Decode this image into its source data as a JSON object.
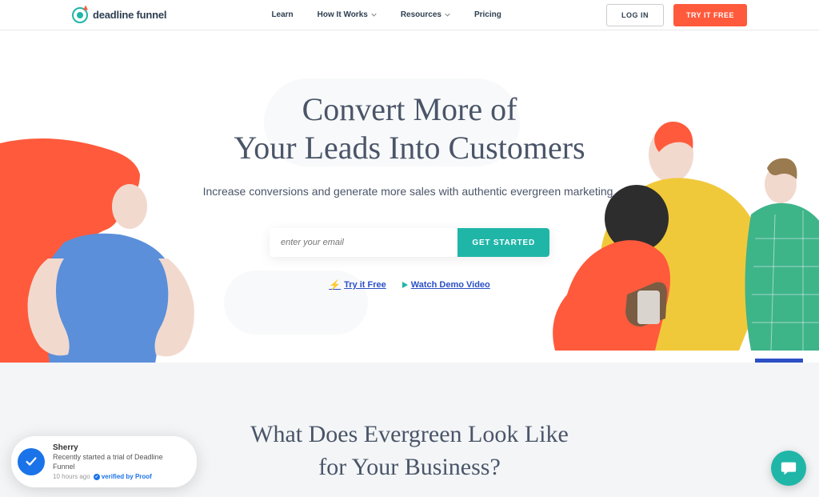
{
  "header": {
    "logo_text": "deadline funnel",
    "nav": [
      {
        "label": "Learn",
        "has_chevron": false
      },
      {
        "label": "How It Works",
        "has_chevron": true
      },
      {
        "label": "Resources",
        "has_chevron": true
      },
      {
        "label": "Pricing",
        "has_chevron": false
      }
    ],
    "login_label": "LOG IN",
    "cta_label": "TRY IT FREE"
  },
  "hero": {
    "title_line1": "Convert More of",
    "title_line2": "Your Leads Into Customers",
    "subtitle": "Increase conversions and generate more sales with authentic evergreen marketing.",
    "email_placeholder": "enter your email",
    "get_started_label": "GET STARTED",
    "try_free_label": "Try it Free",
    "watch_demo_label": "Watch Demo Video"
  },
  "section2": {
    "title_line1": "What Does Evergreen Look Like",
    "title_line2": "for Your Business?"
  },
  "proof": {
    "name": "Sherry",
    "message": "Recently started a trial of Deadline Funnel",
    "time": "10 hours ago",
    "verified_label": "verified by Proof"
  },
  "colors": {
    "accent_teal": "#1fb6a8",
    "accent_orange": "#ff5a3c",
    "link_blue": "#2b4fc7",
    "proof_blue": "#1a73e8"
  }
}
